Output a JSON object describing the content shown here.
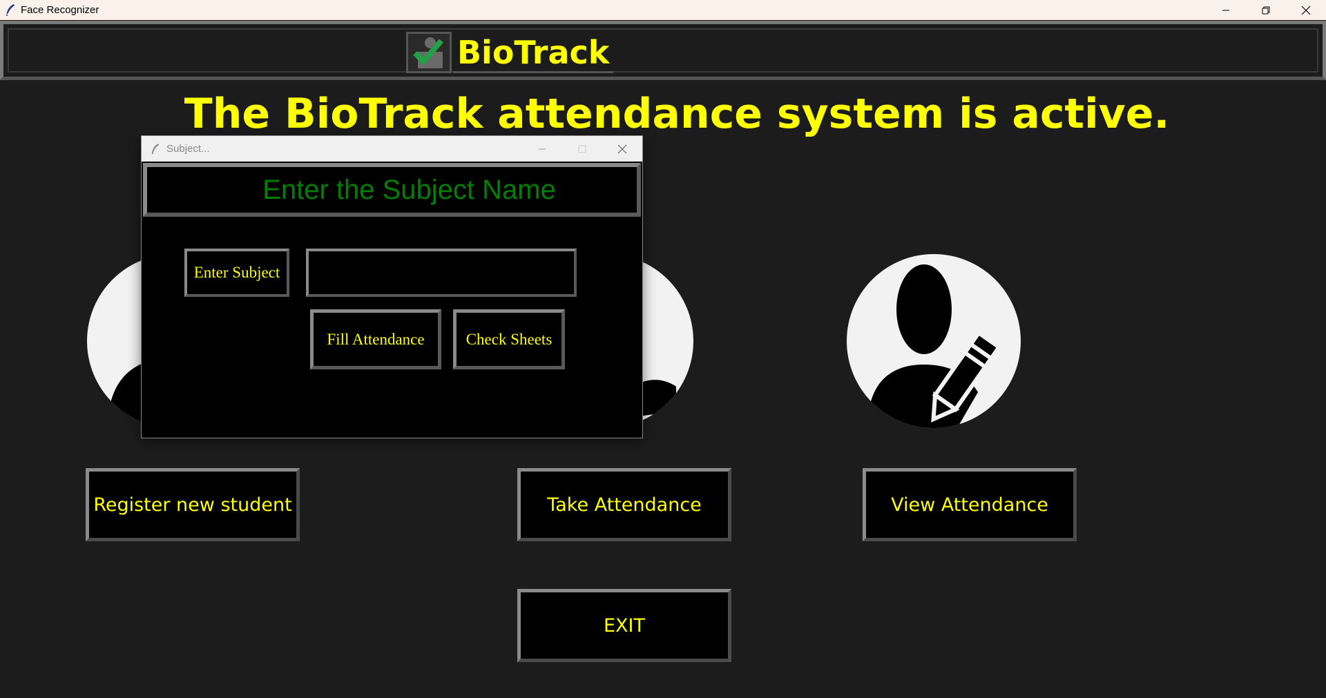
{
  "window": {
    "title": "Face Recognizer"
  },
  "header": {
    "brand": "BioTrack"
  },
  "headline": "The BioTrack attendance system is active.",
  "buttons": {
    "register": "Register new student",
    "take": "Take Attendance",
    "view": "View Attendance",
    "exit": "EXIT"
  },
  "dialog": {
    "title": "Subject...",
    "heading": "Enter the Subject Name",
    "label": "Enter Subject",
    "input_value": "",
    "fill_button": "Fill Attendance",
    "check_button": "Check Sheets"
  },
  "icons": {
    "app": "feather-icon",
    "logo": "checkmark-person-icon",
    "register": "person-silhouette-icon",
    "take": "person-hand-icon",
    "view": "person-pencil-icon"
  },
  "colors": {
    "background": "#1c1c1c",
    "accent": "#ffff00",
    "dialog_heading": "#008000",
    "button_bg": "#000000"
  }
}
